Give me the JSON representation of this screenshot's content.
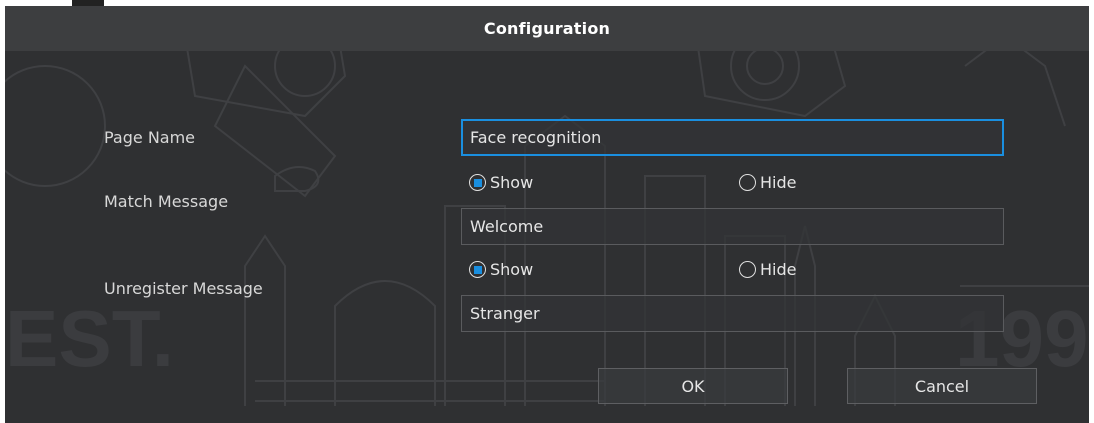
{
  "dialog": {
    "title": "Configuration"
  },
  "form": {
    "page_name": {
      "label": "Page Name",
      "value": "Face recognition"
    },
    "match_message": {
      "label": "Match Message",
      "options": [
        {
          "label": "Show",
          "selected": true
        },
        {
          "label": "Hide",
          "selected": false
        }
      ],
      "value": "Welcome"
    },
    "unregister_message": {
      "label": "Unregister Message",
      "options": [
        {
          "label": "Show",
          "selected": true
        },
        {
          "label": "Hide",
          "selected": false
        }
      ],
      "value": "Stranger"
    }
  },
  "buttons": {
    "ok_label": "OK",
    "cancel_label": "Cancel"
  },
  "background_watermark": {
    "left_text": "EST.",
    "right_text": "199"
  },
  "colors": {
    "accent": "#1a8fe0",
    "dialog_bg": "#2f3032",
    "title_bar_bg": "#3d3e40"
  }
}
